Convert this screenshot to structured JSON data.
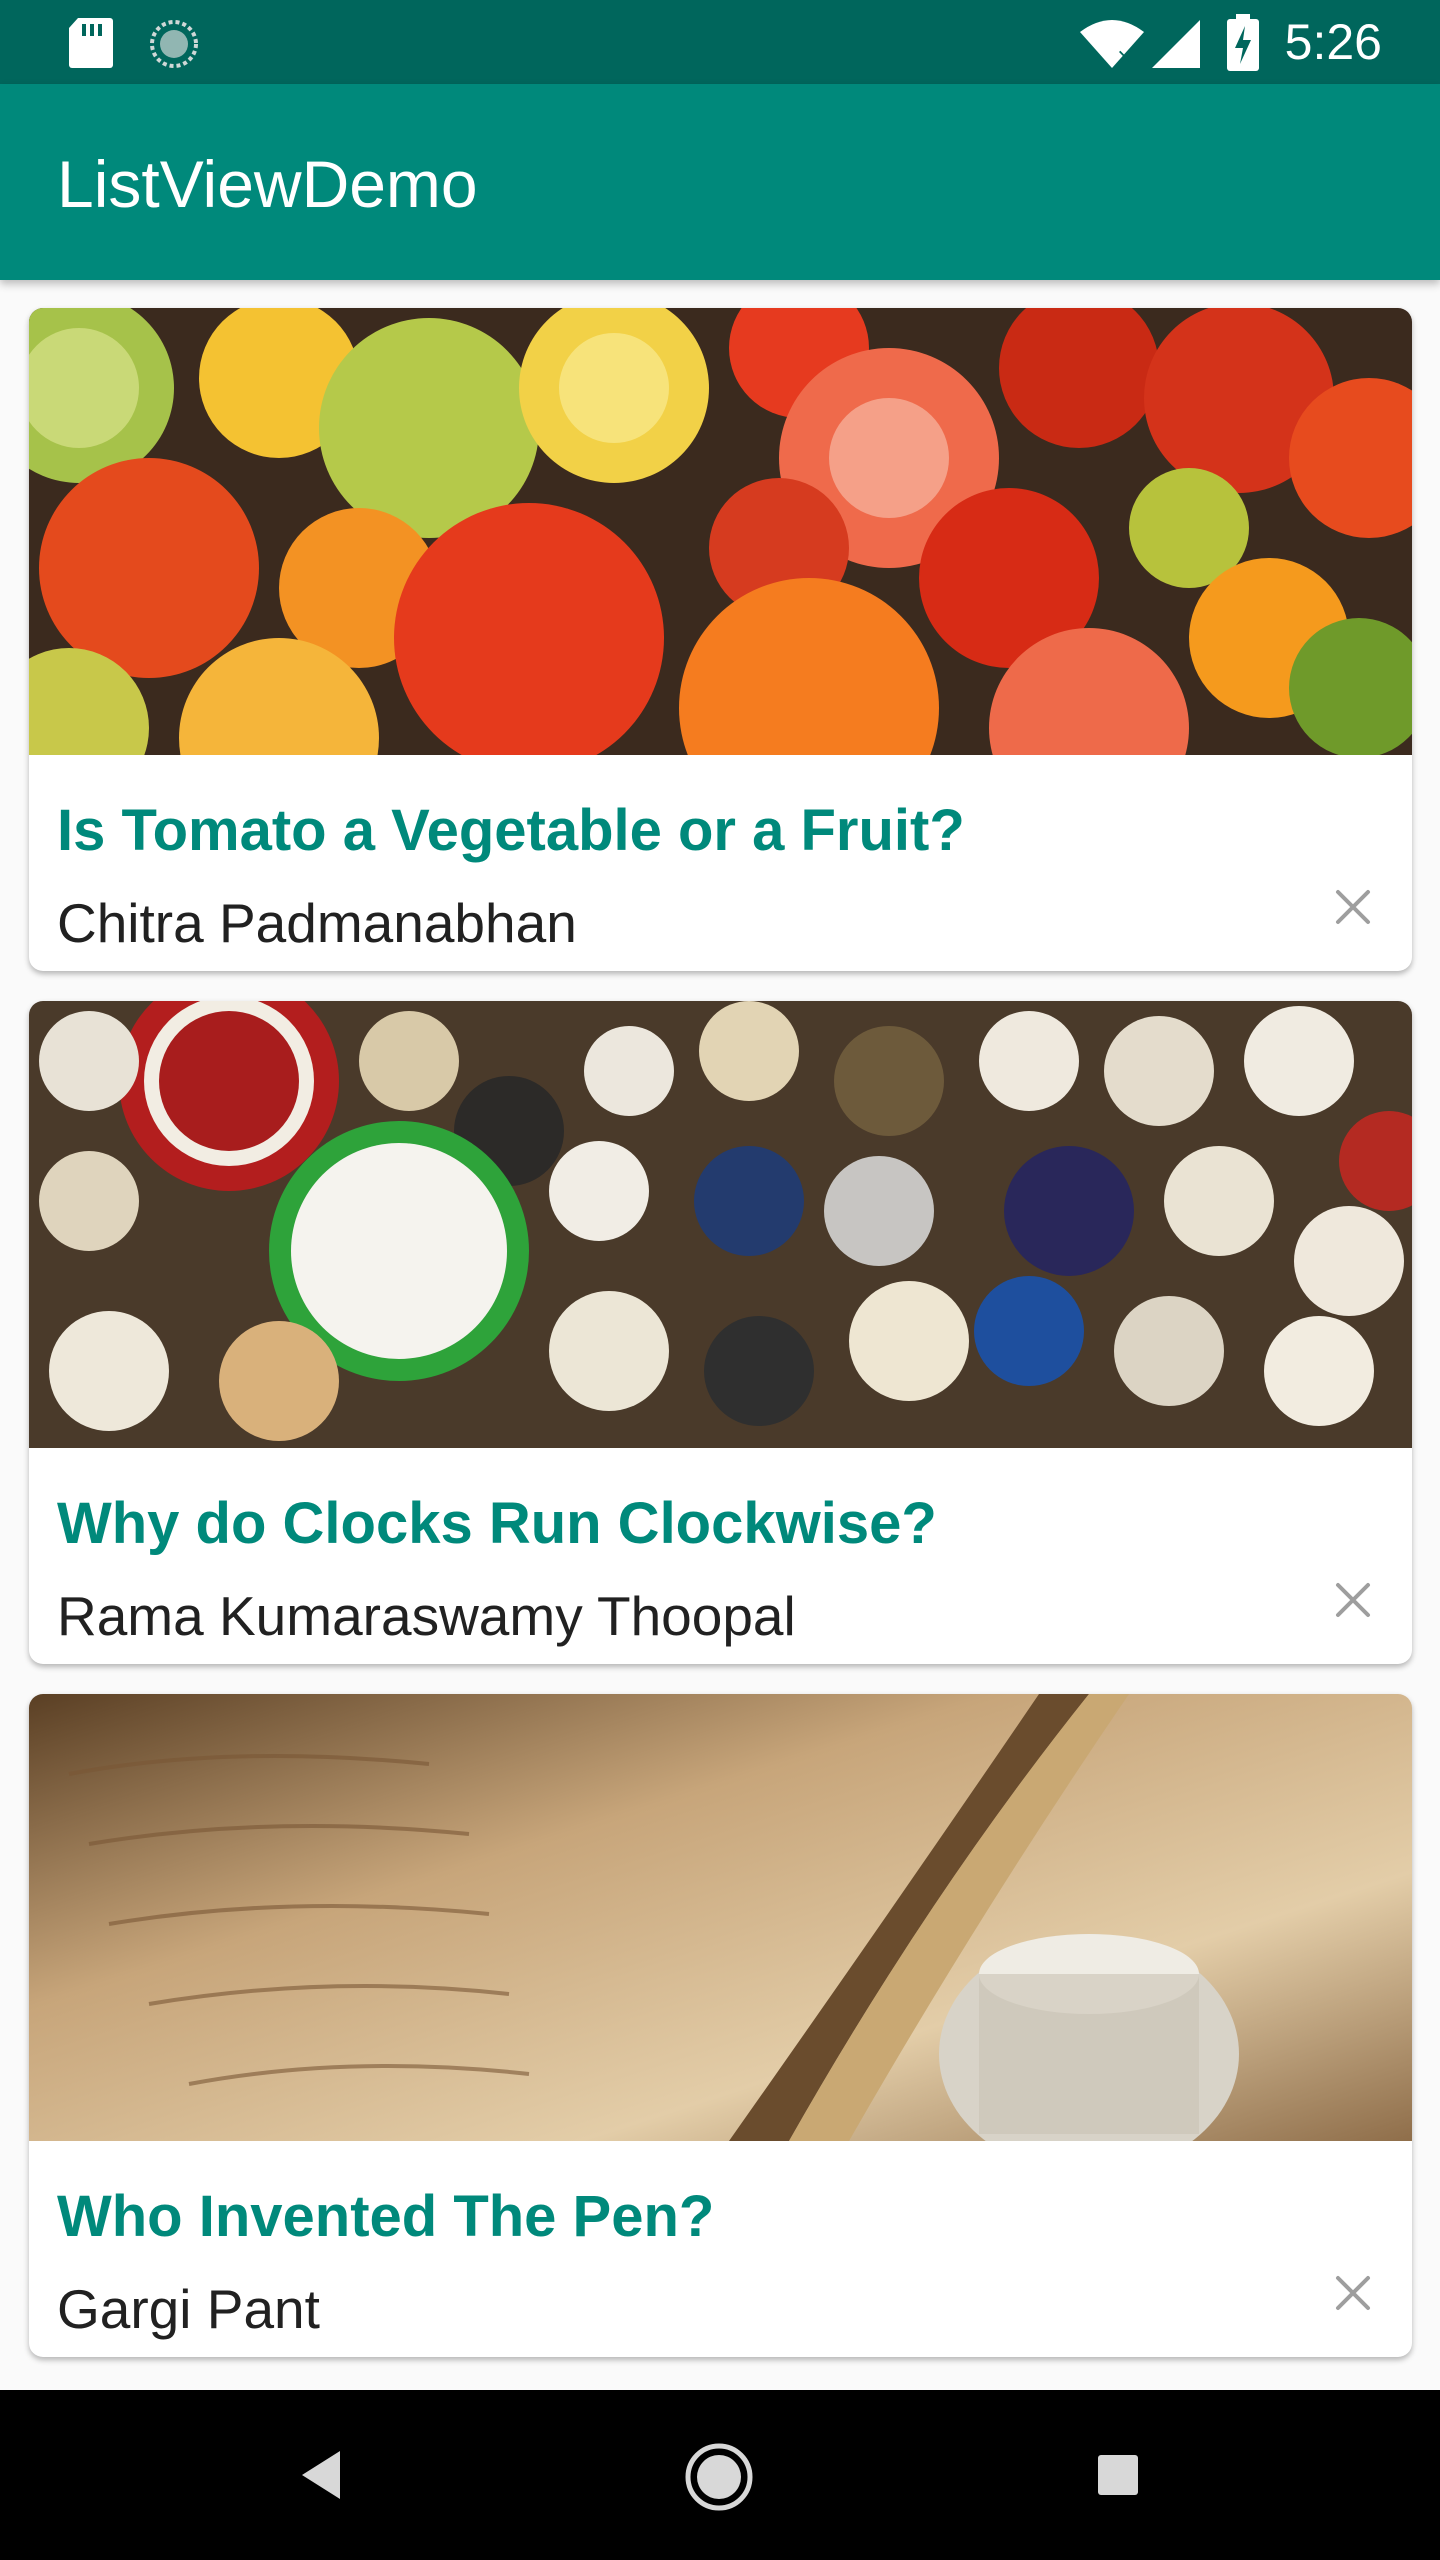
{
  "status_bar": {
    "time": "5:26",
    "icons": [
      "sd-card-icon",
      "sync-icon",
      "wifi-icon",
      "cell-signal-icon",
      "battery-charging-icon"
    ]
  },
  "app_bar": {
    "title": "ListViewDemo"
  },
  "articles": [
    {
      "title": "Is Tomato a Vegetable or a Fruit?",
      "author": "Chitra Padmanabhan",
      "image": "tomatoes-image",
      "close_icon": "close-icon"
    },
    {
      "title": "Why do Clocks Run Clockwise?",
      "author": "Rama Kumaraswamy Thoopal",
      "image": "clocks-image",
      "close_icon": "close-icon"
    },
    {
      "title": "Who Invented The Pen?",
      "author": "Gargi Pant",
      "image": "quill-pen-image",
      "close_icon": "close-icon"
    }
  ],
  "nav_bar": {
    "buttons": [
      "back-icon",
      "home-icon",
      "recents-icon"
    ]
  },
  "colors": {
    "status_bar": "#00665c",
    "app_bar": "#00897b",
    "title_text": "#00897b",
    "author_text": "#212121",
    "background": "#fafafa"
  }
}
